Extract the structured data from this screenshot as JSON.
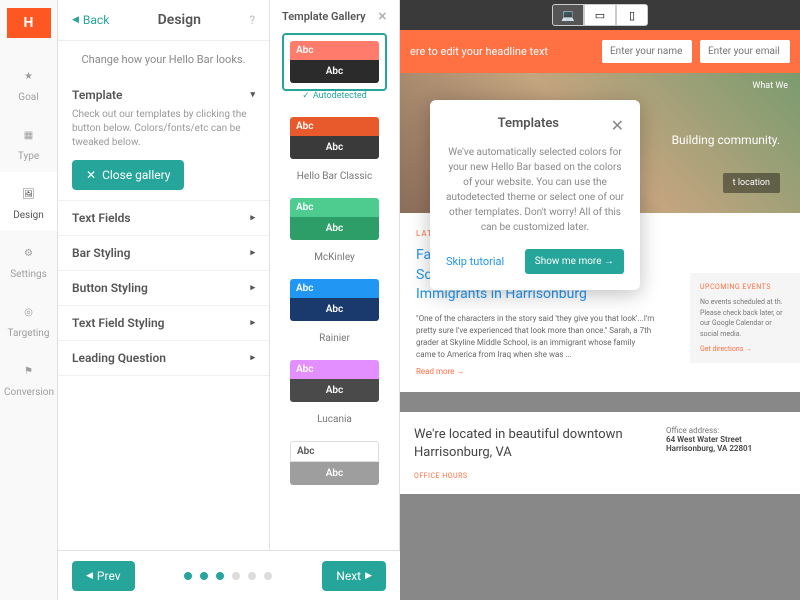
{
  "sidebar": {
    "logo": "H",
    "items": [
      {
        "label": "Goal",
        "icon": "star"
      },
      {
        "label": "Type",
        "icon": "grid"
      },
      {
        "label": "Design",
        "icon": "image",
        "active": true
      },
      {
        "label": "Settings",
        "icon": "sliders"
      },
      {
        "label": "Targeting",
        "icon": "target"
      },
      {
        "label": "Conversion",
        "icon": "flag"
      }
    ]
  },
  "panel": {
    "back": "Back",
    "title": "Design",
    "subtitle": "Change how your Hello Bar looks.",
    "template_heading": "Template",
    "template_desc": "Check out our templates by clicking the button below. Colors/fonts/etc can be tweaked below.",
    "close_gallery": "Close gallery",
    "sections": [
      "Text Fields",
      "Bar Styling",
      "Button Styling",
      "Text Field Styling",
      "Leading Question"
    ]
  },
  "gallery": {
    "title": "Template Gallery",
    "autodetected": "Autodetected",
    "sample": "Abc",
    "templates": [
      {
        "name": "",
        "bar": "#ff7b6b",
        "btn": "#2b2b2b",
        "selected": true,
        "auto": true
      },
      {
        "name": "Hello Bar Classic",
        "bar": "#e85a2b",
        "btn": "#3a3a3a"
      },
      {
        "name": "McKinley",
        "bar": "#4ecb8f",
        "btn": "#2e9e68"
      },
      {
        "name": "Rainier",
        "bar": "#2196f3",
        "btn": "#1a3a6e"
      },
      {
        "name": "Lucania",
        "bar": "#e48fff",
        "btn": "#4a4a4a"
      },
      {
        "name": "",
        "bar": "#ffffff",
        "btn": "#9e9e9e",
        "dark_text": true
      }
    ]
  },
  "preview": {
    "hello_bar_text": "ere to edit your headline text",
    "name_placeholder": "Enter your name",
    "email_placeholder": "Enter your email",
    "hero_nav": "What We",
    "hero_tag": "Building community.",
    "hero_btn": "t location",
    "blog_label": "LATEST FROM THE BLOG",
    "blog_title": "Faces of Freedom: Skyline Middle School Play Brings Hope for Immigrants in Harrisonburg",
    "blog_quote": "\"One of the characters in the story said 'they give you that look'...I'm pretty sure I've experienced that look more than once.\" Sarah, a 7th grader at Skyline Middle School, is an immigrant whose family came to America from Iraq when she was ...",
    "read_more": "Read more →",
    "events_label": "UPCOMING EVENTS",
    "events_text": "No events scheduled at th. Please check back later, or our Google Calendar or social media.",
    "directions": "Get directions →",
    "location_title": "We're located in beautiful downtown Harrisonburg, VA",
    "office_label": "Office address:",
    "address1": "64 West Water Street",
    "address2": "Harrisonburg, VA 22801",
    "hours_label": "OFFICE HOURS"
  },
  "popup": {
    "title": "Templates",
    "body": "We've automatically selected colors for your new Hello Bar based on the colors of your website. You can use the autodetected theme or select one of our other templates. Don't worry! All of this can be customized later.",
    "skip": "Skip tutorial",
    "more": "Show me more →"
  },
  "footer": {
    "prev": "Prev",
    "next": "Next",
    "step": 3,
    "total": 6
  }
}
